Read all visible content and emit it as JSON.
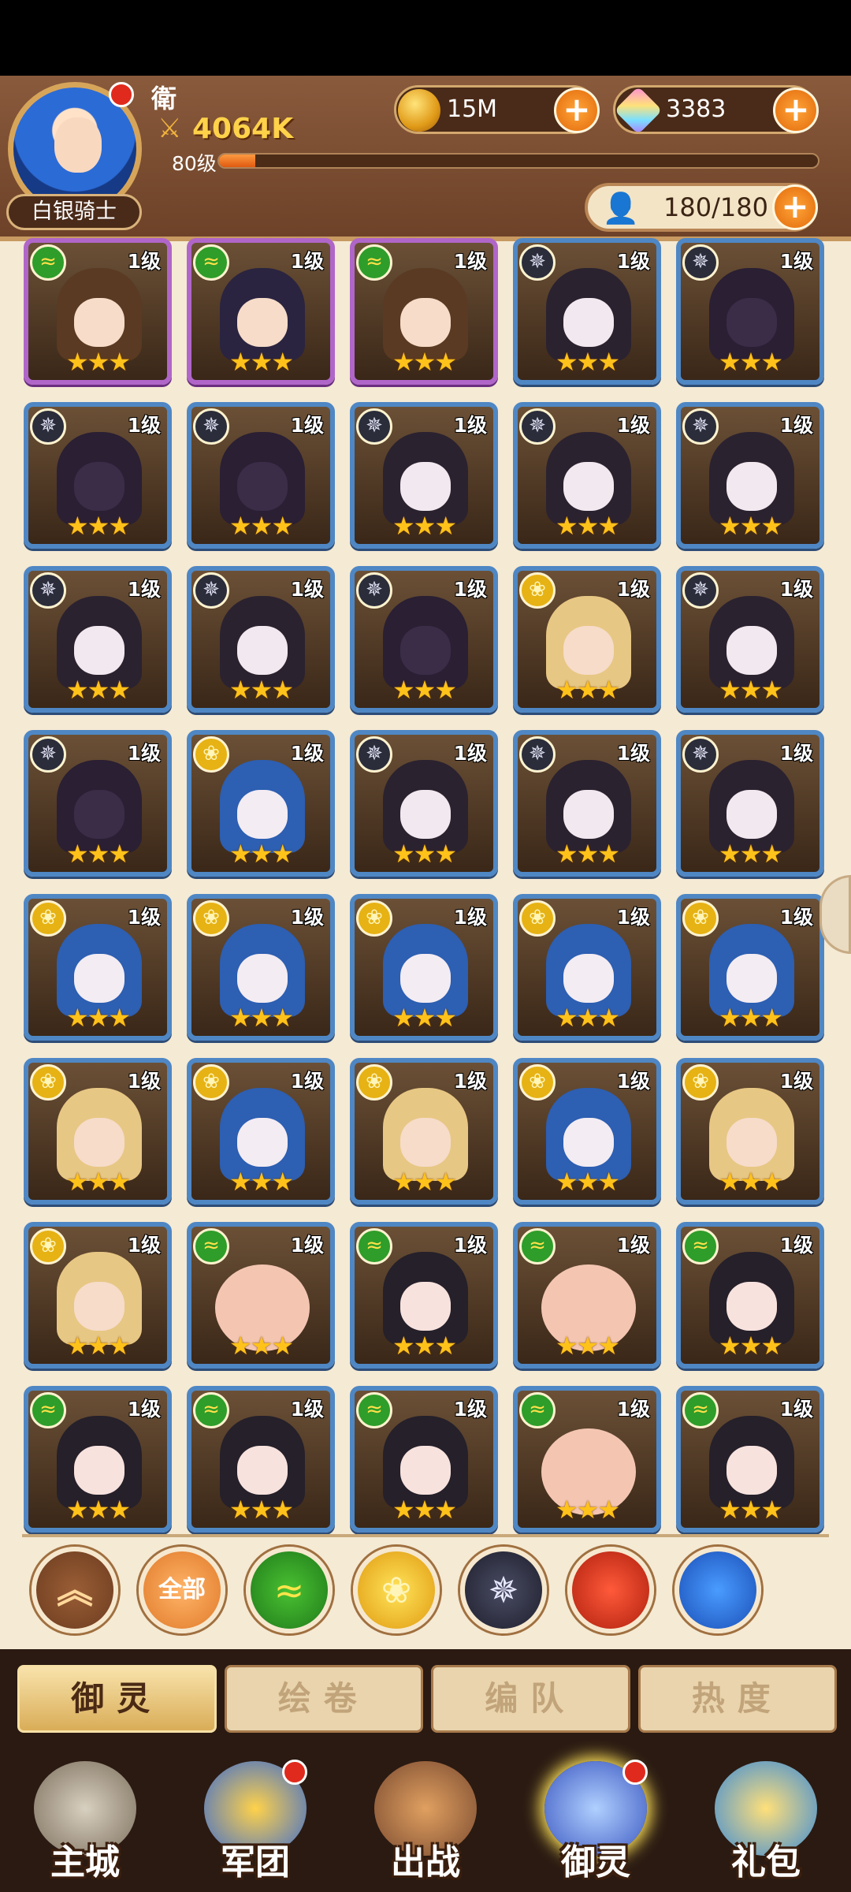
{
  "header": {
    "player_name": "衛",
    "power": "4064K",
    "level_label": "80级",
    "xp_progress_pct": 6,
    "rank_title": "白银骑士",
    "gold": "15M",
    "gems": "3383",
    "capacity": "180/180"
  },
  "icons": {
    "power": "crossed-swords-icon",
    "gold": "gold-coin-icon",
    "gems": "crystal-gem-icon",
    "capacity": "person-icon",
    "plus": "plus-icon"
  },
  "cards": [
    {
      "level": "1级",
      "stars": "★★★",
      "faction": "nature",
      "art": "brown",
      "rarity": "purple"
    },
    {
      "level": "1级",
      "stars": "★★★",
      "faction": "nature",
      "art": "dark2",
      "rarity": "purple"
    },
    {
      "level": "1级",
      "stars": "★★★",
      "faction": "nature",
      "art": "brown",
      "rarity": "purple"
    },
    {
      "level": "1级",
      "stars": "★★★",
      "faction": "dark",
      "art": "hood",
      "rarity": "blue"
    },
    {
      "level": "1级",
      "stars": "★★★",
      "faction": "dark",
      "art": "knight",
      "rarity": "blue"
    },
    {
      "level": "1级",
      "stars": "★★★",
      "faction": "dark",
      "art": "knight",
      "rarity": "blue"
    },
    {
      "level": "1级",
      "stars": "★★★",
      "faction": "dark",
      "art": "knight",
      "rarity": "blue"
    },
    {
      "level": "1级",
      "stars": "★★★",
      "faction": "dark",
      "art": "hood",
      "rarity": "blue"
    },
    {
      "level": "1级",
      "stars": "★★★",
      "faction": "dark",
      "art": "hood",
      "rarity": "blue"
    },
    {
      "level": "1级",
      "stars": "★★★",
      "faction": "dark",
      "art": "hood",
      "rarity": "blue"
    },
    {
      "level": "1级",
      "stars": "★★★",
      "faction": "dark",
      "art": "hood",
      "rarity": "blue"
    },
    {
      "level": "1级",
      "stars": "★★★",
      "faction": "dark",
      "art": "hood",
      "rarity": "blue"
    },
    {
      "level": "1级",
      "stars": "★★★",
      "faction": "dark",
      "art": "knight",
      "rarity": "blue"
    },
    {
      "level": "1级",
      "stars": "★★★",
      "faction": "light",
      "art": "blonde",
      "rarity": "blue"
    },
    {
      "level": "1级",
      "stars": "★★★",
      "faction": "dark",
      "art": "hood",
      "rarity": "blue"
    },
    {
      "level": "1级",
      "stars": "★★★",
      "faction": "dark",
      "art": "knight",
      "rarity": "blue"
    },
    {
      "level": "1级",
      "stars": "★★★",
      "faction": "light",
      "art": "blue",
      "rarity": "blue"
    },
    {
      "level": "1级",
      "stars": "★★★",
      "faction": "dark",
      "art": "hood",
      "rarity": "blue"
    },
    {
      "level": "1级",
      "stars": "★★★",
      "faction": "dark",
      "art": "hood",
      "rarity": "blue"
    },
    {
      "level": "1级",
      "stars": "★★★",
      "faction": "dark",
      "art": "hood",
      "rarity": "blue"
    },
    {
      "level": "1级",
      "stars": "★★★",
      "faction": "light",
      "art": "blue",
      "rarity": "blue"
    },
    {
      "level": "1级",
      "stars": "★★★",
      "faction": "light",
      "art": "blue",
      "rarity": "blue"
    },
    {
      "level": "1级",
      "stars": "★★★",
      "faction": "light",
      "art": "blue",
      "rarity": "blue"
    },
    {
      "level": "1级",
      "stars": "★★★",
      "faction": "light",
      "art": "blue",
      "rarity": "blue"
    },
    {
      "level": "1级",
      "stars": "★★★",
      "faction": "light",
      "art": "blue",
      "rarity": "blue"
    },
    {
      "level": "1级",
      "stars": "★★★",
      "faction": "light",
      "art": "blonde",
      "rarity": "blue"
    },
    {
      "level": "1级",
      "stars": "★★★",
      "faction": "light",
      "art": "blue",
      "rarity": "blue"
    },
    {
      "level": "1级",
      "stars": "★★★",
      "faction": "light",
      "art": "blonde",
      "rarity": "blue"
    },
    {
      "level": "1级",
      "stars": "★★★",
      "faction": "light",
      "art": "blue",
      "rarity": "blue"
    },
    {
      "level": "1级",
      "stars": "★★★",
      "faction": "light",
      "art": "blonde",
      "rarity": "blue"
    },
    {
      "level": "1级",
      "stars": "★★★",
      "faction": "light",
      "art": "blonde",
      "rarity": "blue"
    },
    {
      "level": "1级",
      "stars": "★★★",
      "faction": "nature",
      "art": "monk",
      "rarity": "blue"
    },
    {
      "level": "1级",
      "stars": "★★★",
      "faction": "nature",
      "art": "girl",
      "rarity": "blue"
    },
    {
      "level": "1级",
      "stars": "★★★",
      "faction": "nature",
      "art": "monk",
      "rarity": "blue"
    },
    {
      "level": "1级",
      "stars": "★★★",
      "faction": "nature",
      "art": "girl",
      "rarity": "blue"
    },
    {
      "level": "1级",
      "stars": "★★★",
      "faction": "nature",
      "art": "girl",
      "rarity": "blue"
    },
    {
      "level": "1级",
      "stars": "★★★",
      "faction": "nature",
      "art": "girl",
      "rarity": "blue"
    },
    {
      "level": "1级",
      "stars": "★★★",
      "faction": "nature",
      "art": "girl",
      "rarity": "blue"
    },
    {
      "level": "1级",
      "stars": "★★★",
      "faction": "nature",
      "art": "monk",
      "rarity": "blue"
    },
    {
      "level": "1级",
      "stars": "★★★",
      "faction": "nature",
      "art": "girl",
      "rarity": "blue"
    }
  ],
  "faction_glyphs": {
    "nature": "≈",
    "dark": "✵",
    "light": "❀"
  },
  "filters": {
    "collapse_glyph": "︽",
    "all_label": "全部",
    "nature_glyph": "≈",
    "light_glyph": "❀",
    "dark_glyph": "✵",
    "fire_glyph": "",
    "water_glyph": ""
  },
  "subtabs": [
    "御灵",
    "绘卷",
    "编队",
    "热度"
  ],
  "nav": [
    "主城",
    "军团",
    "出战",
    "御灵",
    "礼包"
  ]
}
